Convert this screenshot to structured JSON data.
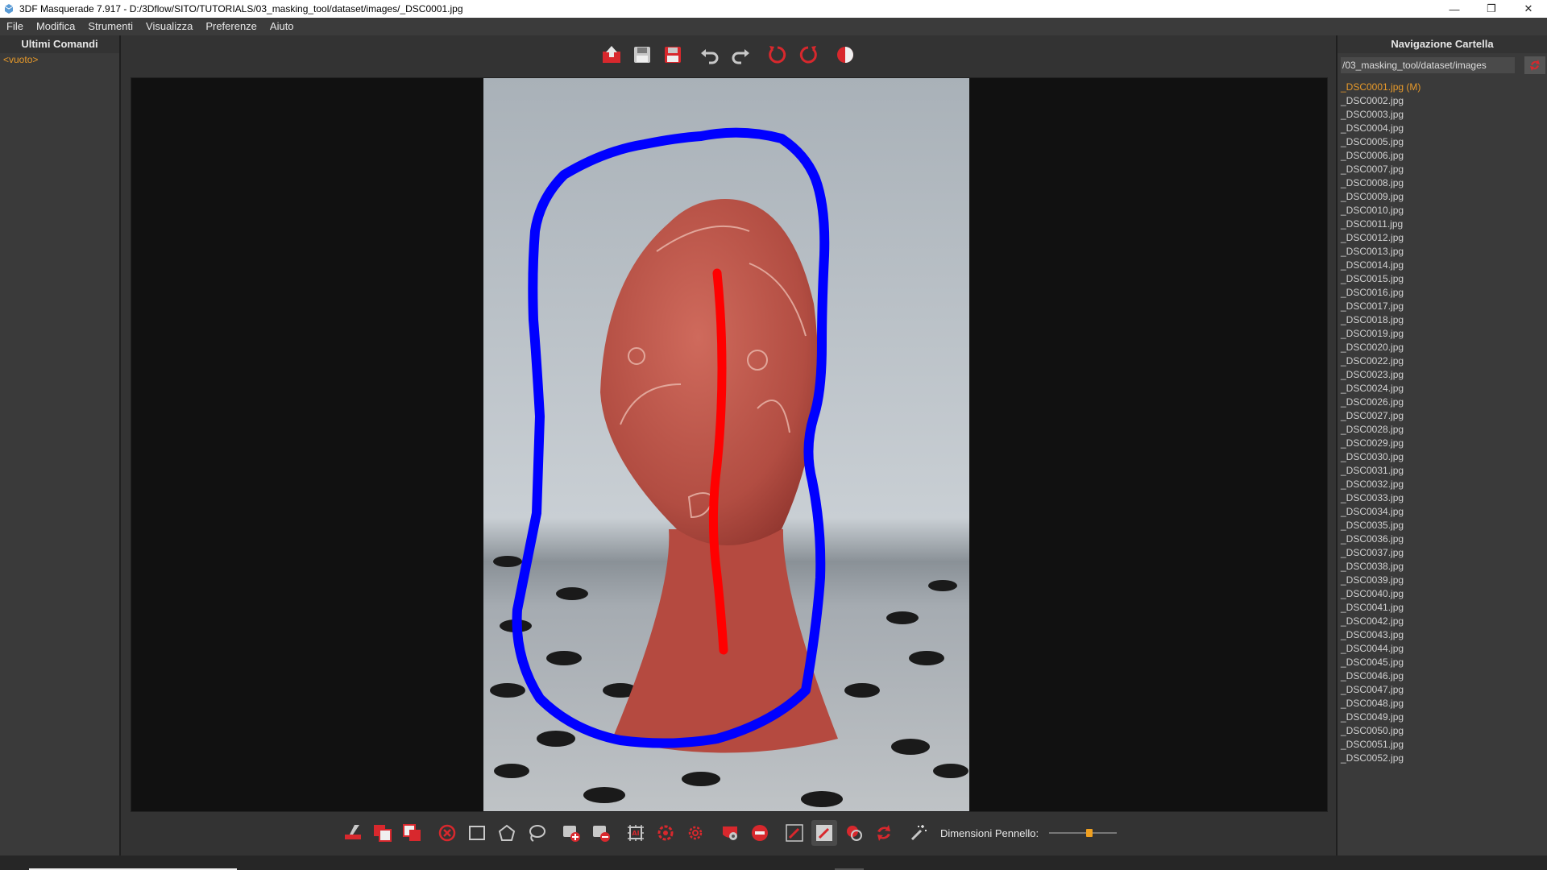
{
  "window": {
    "title": "3DF Masquerade 7.917 - D:/3Dflow/SITO/TUTORIALS/03_masking_tool/dataset/images/_DSC0001.jpg",
    "controls": [
      "minimize-icon",
      "restore-icon",
      "close-icon"
    ]
  },
  "menu": {
    "items": [
      "File",
      "Modifica",
      "Strumenti",
      "Visualizza",
      "Preferenze",
      "Aiuto"
    ]
  },
  "left_panel": {
    "title": "Ultimi Comandi",
    "empty_text": "<vuoto>"
  },
  "top_toolbar": {
    "icons": [
      "import-icon",
      "save-icon",
      "save-all-icon",
      "undo-icon",
      "redo-icon",
      "rotate-left-icon",
      "rotate-right-icon",
      "contrast-icon"
    ]
  },
  "bottom_toolbar": {
    "icons": [
      "clear-mask-icon",
      "add-mask-icon",
      "subtract-mask-icon",
      "cancel-icon",
      "rectangle-icon",
      "polygon-icon",
      "lasso-icon",
      "add-region-icon",
      "remove-region-icon",
      "ai-mask-icon",
      "settings-icon",
      "gear-icon",
      "mask-settings-icon",
      "remove-stroke-icon",
      "brush-icon",
      "brush-active-icon",
      "fill-icon",
      "refresh-icon",
      "magic-wand-icon"
    ],
    "brush_label": "Dimensioni Pennello:",
    "brush_size_fraction": 0.6,
    "colors": {
      "accent": "#d8282d",
      "background": "#333333"
    }
  },
  "right_panel": {
    "title": "Navigazione Cartella",
    "path": "/03_masking_tool/dataset/images",
    "files": [
      "_DSC0001.jpg (M)",
      "_DSC0002.jpg",
      "_DSC0003.jpg",
      "_DSC0004.jpg",
      "_DSC0005.jpg",
      "_DSC0006.jpg",
      "_DSC0007.jpg",
      "_DSC0008.jpg",
      "_DSC0009.jpg",
      "_DSC0010.jpg",
      "_DSC0011.jpg",
      "_DSC0012.jpg",
      "_DSC0013.jpg",
      "_DSC0014.jpg",
      "_DSC0015.jpg",
      "_DSC0016.jpg",
      "_DSC0017.jpg",
      "_DSC0018.jpg",
      "_DSC0019.jpg",
      "_DSC0020.jpg",
      "_DSC0022.jpg",
      "_DSC0023.jpg",
      "_DSC0024.jpg",
      "_DSC0026.jpg",
      "_DSC0027.jpg",
      "_DSC0028.jpg",
      "_DSC0029.jpg",
      "_DSC0030.jpg",
      "_DSC0031.jpg",
      "_DSC0032.jpg",
      "_DSC0033.jpg",
      "_DSC0034.jpg",
      "_DSC0035.jpg",
      "_DSC0036.jpg",
      "_DSC0037.jpg",
      "_DSC0038.jpg",
      "_DSC0039.jpg",
      "_DSC0040.jpg",
      "_DSC0041.jpg",
      "_DSC0042.jpg",
      "_DSC0043.jpg",
      "_DSC0044.jpg",
      "_DSC0045.jpg",
      "_DSC0046.jpg",
      "_DSC0047.jpg",
      "_DSC0048.jpg",
      "_DSC0049.jpg",
      "_DSC0050.jpg",
      "_DSC0051.jpg",
      "_DSC0052.jpg"
    ],
    "current_file": "_DSC0001.jpg (M)"
  },
  "canvas": {
    "background_stroke_color": "#0000ff",
    "foreground_stroke_color": "#ff0000",
    "mask_tint": "#c8463c"
  }
}
